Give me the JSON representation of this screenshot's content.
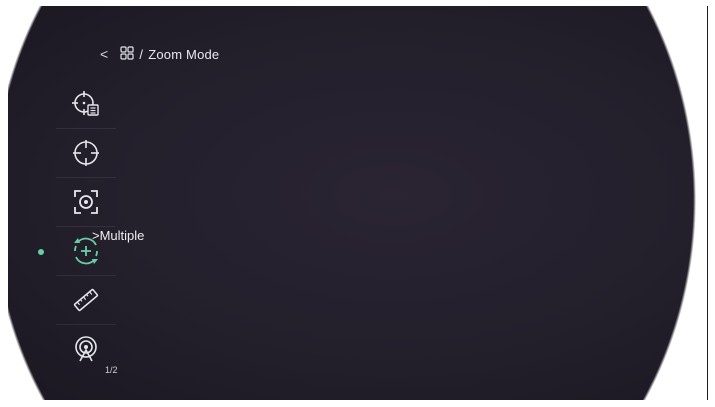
{
  "header": {
    "back_glyph": "<",
    "breadcrumb_separator": "/",
    "title": "Zoom Mode"
  },
  "menu": {
    "items": [
      {
        "icon": "reticle-settings-icon",
        "active": false
      },
      {
        "icon": "crosshair-icon",
        "active": false
      },
      {
        "icon": "focus-frame-icon",
        "active": false
      },
      {
        "icon": "zoom-mode-icon",
        "active": true,
        "value": ">Multiple"
      },
      {
        "icon": "ruler-icon",
        "active": false
      },
      {
        "icon": "hotspot-tracking-icon",
        "active": false
      }
    ],
    "page": "1/2"
  },
  "colors": {
    "accent": "#62d2a2",
    "text": "#e9e9ee",
    "scope_background": "#231f2b"
  }
}
